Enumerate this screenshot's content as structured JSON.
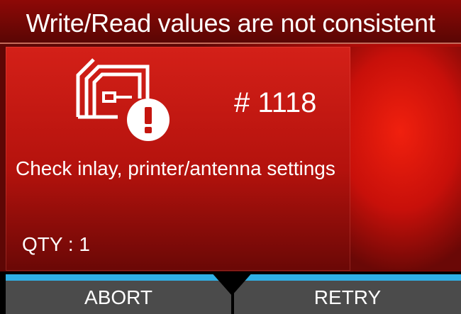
{
  "dialog": {
    "title": "Write/Read values are not consistent",
    "error_code": "# 1118",
    "message": "Check inlay, printer/antenna settings",
    "quantity": "QTY : 1",
    "icon": "rfid-warning-icon"
  },
  "buttons": {
    "abort_label": "ABORT",
    "retry_label": "RETRY"
  },
  "colors": {
    "background": "#c8100a",
    "accent_line": "#2fb0e6",
    "button_bg": "#4b4b4b",
    "text": "#ffffff"
  }
}
